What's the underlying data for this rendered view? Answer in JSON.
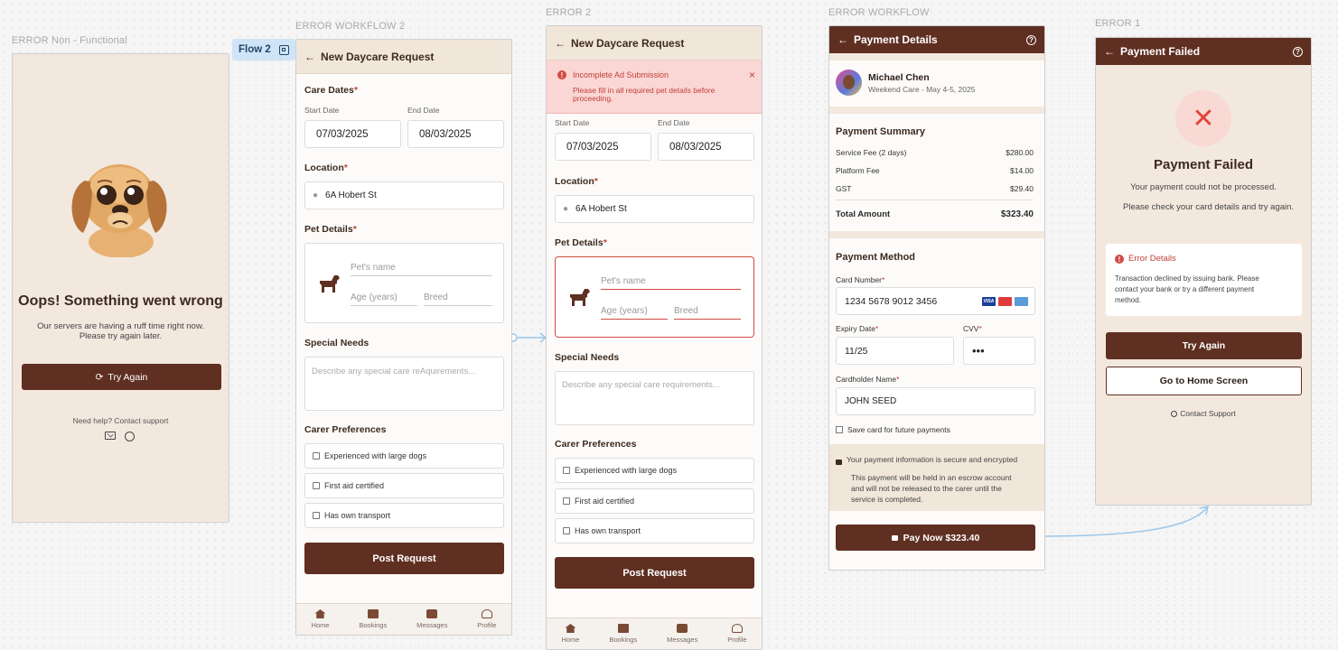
{
  "frame_labels": {
    "error_non_functional": "ERROR Non - Functional",
    "error_workflow_2": "ERROR WORKFLOW 2",
    "error_2": "ERROR 2",
    "error_workflow": "ERROR WORKFLOW",
    "error_1": "ERROR 1",
    "flow_tag": "Flow 2"
  },
  "screen1": {
    "title": "Oops! Something went wrong",
    "message_line1": "Our servers are having a ruff time right now.",
    "message_line2": "Please try again later.",
    "try_again": "Try Again",
    "help": "Need help? Contact support"
  },
  "screen2": {
    "header": "New Daycare Request",
    "care_dates": "Care Dates",
    "start_date_label": "Start Date",
    "end_date_label": "End Date",
    "start_date": "07/03/2025",
    "end_date": "08/03/2025",
    "location_label": "Location",
    "location": "6A Hobert St",
    "pet_details": "Pet Details",
    "pet_name_placeholder": "Pet's name",
    "age_placeholder": "Age (years)",
    "breed_placeholder": "Breed",
    "special_needs": "Special Needs",
    "special_needs_placeholder": "Describe any special care reAquirements...",
    "carer_prefs": "Carer Preferences",
    "pref1": "Experienced with large dogs",
    "pref2": "First aid certified",
    "pref3": "Has own transport",
    "post": "Post Request"
  },
  "screen3": {
    "header": "New Daycare Request",
    "alert_title": "Incomplete Ad Submission",
    "alert_msg_line1": "Please fill in all required pet details before",
    "alert_msg_line2": "proceeding.",
    "start_date_label": "Start Date",
    "end_date_label": "End Date",
    "start_date": "07/03/2025",
    "end_date": "08/03/2025",
    "location_label": "Location",
    "location": "6A Hobert St",
    "pet_details": "Pet Details",
    "pet_name_placeholder": "Pet's name",
    "age_placeholder": "Age (years)",
    "breed_placeholder": "Breed",
    "special_needs": "Special Needs",
    "special_needs_placeholder": "Describe any special care requirements...",
    "carer_prefs": "Carer Preferences",
    "pref1": "Experienced with large dogs",
    "pref2": "First aid certified",
    "pref3": "Has own transport",
    "post": "Post Request"
  },
  "nav": {
    "home": "Home",
    "bookings": "Bookings",
    "messages": "Messages",
    "profile": "Profile"
  },
  "screen4": {
    "header": "Payment Details",
    "carer_name": "Michael Chen",
    "carer_sub": "Weekend Care - May 4-5, 2025",
    "summary_title": "Payment Summary",
    "service_fee_label": "Service Fee (2 days)",
    "service_fee": "$280.00",
    "platform_fee_label": "Platform Fee",
    "platform_fee": "$14.00",
    "gst_label": "GST",
    "gst": "$29.40",
    "total_label": "Total Amount",
    "total": "$323.40",
    "method_title": "Payment Method",
    "card_number_label": "Card Number",
    "card_number": "1234 5678 9012 3456",
    "card_visa": "VISA",
    "expiry_label": "Expiry Date",
    "expiry": "11/25",
    "cvv_label": "CVV",
    "cvv": "•••",
    "holder_label": "Cardholder Name",
    "holder": "JOHN SEED",
    "save_card": "Save card for future payments",
    "secure": "Your payment information is secure and encrypted",
    "escrow_line1": "This payment will be held in an escrow account",
    "escrow_line2": "and will not be released to the carer until the",
    "escrow_line3": "service is completed.",
    "pay": "Pay Now $323.40"
  },
  "screen5": {
    "header": "Payment Failed",
    "title": "Payment Failed",
    "line1": "Your payment could not be processed.",
    "line2": "Please check your card details and try again.",
    "error_title": "Error Details",
    "error_line1": "Transaction declined by issuing bank. Please",
    "error_line2": "contact your bank or try a different payment",
    "error_line3": "method.",
    "try_again": "Try Again",
    "home": "Go to Home Screen",
    "support": "Contact Support"
  },
  "colors": {
    "brand_brown": "#5f2f22",
    "cream": "#f3e8de",
    "error_red": "#d04a43"
  }
}
